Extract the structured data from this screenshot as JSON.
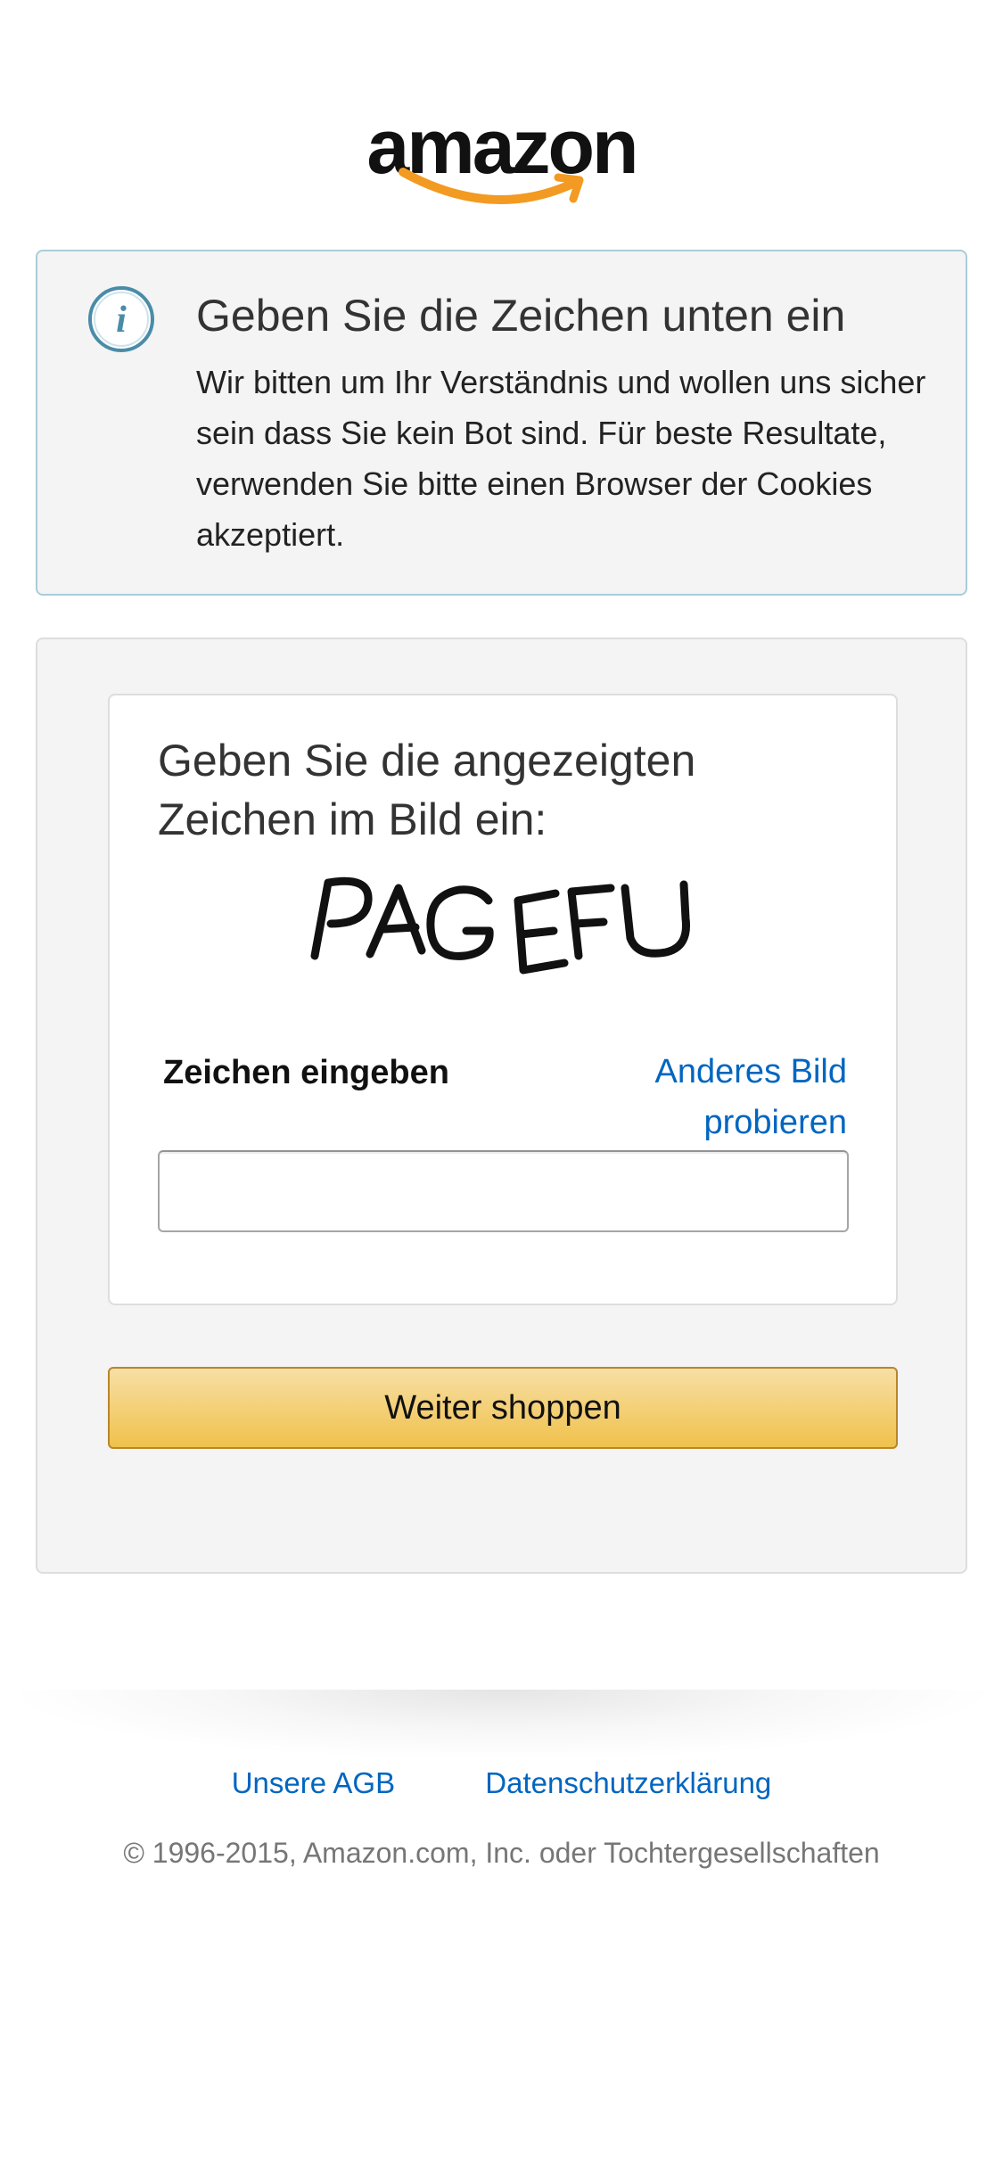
{
  "header": {
    "logo_text": "amazon"
  },
  "info_box": {
    "icon": "info-icon",
    "title": "Geben Sie die Zeichen unten ein",
    "message": "Wir bitten um Ihr Verständnis und wollen uns sicher sein dass Sie kein Bot sind. Für beste Resultate, verwenden Sie bitte einen Browser der Cookies akzeptiert."
  },
  "captcha": {
    "prompt": "Geben Sie die angezeigten Zeichen im Bild ein:",
    "image_text": "PAGEFU",
    "field_label": "Zeichen eingeben",
    "other_image_link": "Anderes Bild probieren",
    "input_value": "",
    "input_placeholder": ""
  },
  "continue_button": {
    "label": "Weiter shoppen"
  },
  "footer": {
    "links": [
      "Unsere AGB",
      "Datenschutzerklärung"
    ],
    "copyright": "© 1996-2015, Amazon.com, Inc. oder Tochtergesellschaften"
  },
  "colors": {
    "link": "#0066c0",
    "button_top": "#f7dfa5",
    "button_bottom": "#f0c14b",
    "info_border": "#a9cdd8",
    "info_icon": "#4a8ca8",
    "logo_smile": "#f29a21"
  }
}
